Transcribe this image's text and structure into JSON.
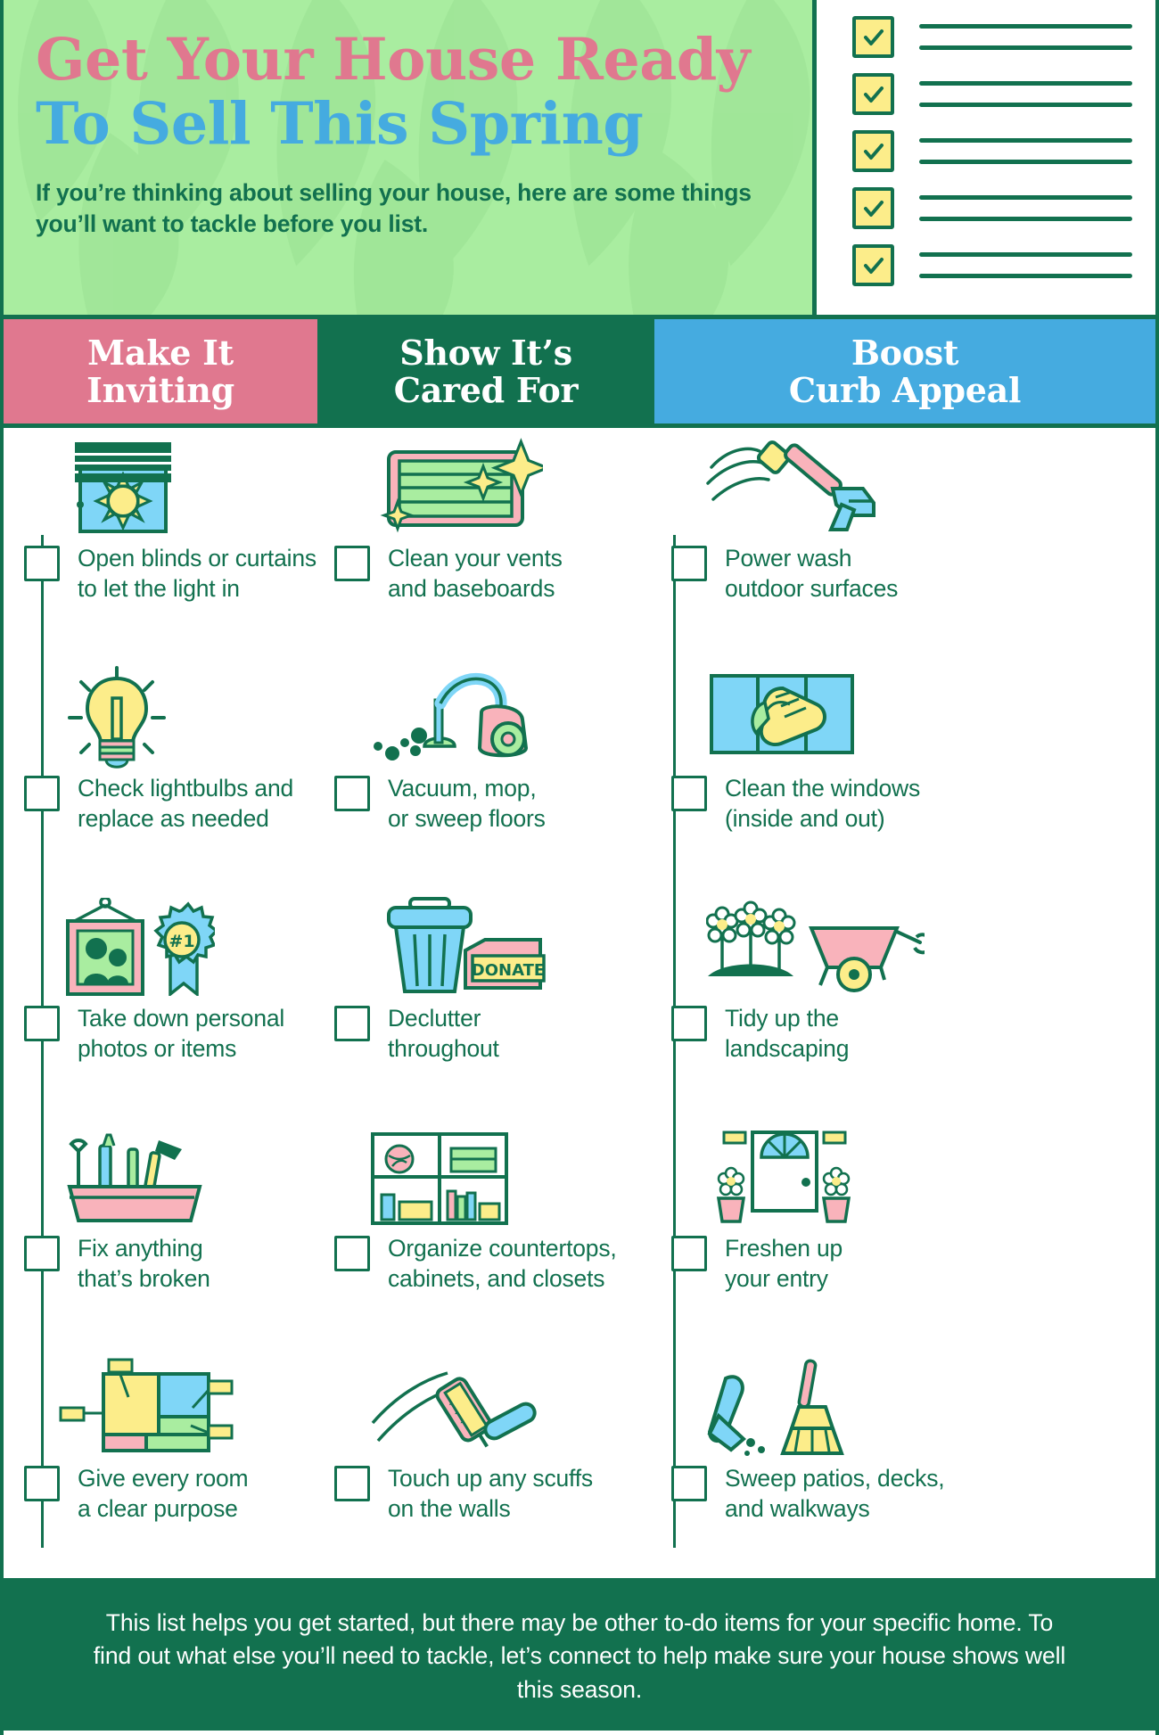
{
  "header": {
    "title_line1": "Get Your House Ready",
    "title_line2": "To Sell This Spring",
    "subtitle": "If you’re thinking about selling your house, here are some things you’ll want to tackle before you list.",
    "checklist_graphic": {
      "rows": 5,
      "checkmark_icon": "check-icon",
      "box_fill": "#FCED8A",
      "box_border": "#12714F",
      "line_color": "#12714F"
    }
  },
  "colors": {
    "green": "#12714F",
    "light_green": "#A9EDA0",
    "pink": "#E0788F",
    "light_pink": "#F9B3BB",
    "blue": "#45ABE0",
    "light_blue": "#7FD6F7",
    "yellow": "#FCED8A",
    "white": "#FFFFFF"
  },
  "columns": [
    {
      "heading": "Make It\nInviting",
      "heading_line1": "Make It",
      "heading_line2": "Inviting",
      "accent": "#E0788F",
      "items": [
        {
          "icon": "window-blinds-sun-icon",
          "line1": "Open blinds or curtains",
          "line2": "to let the light in"
        },
        {
          "icon": "lightbulb-icon",
          "line1": "Check lightbulbs and",
          "line2": "replace as needed"
        },
        {
          "icon": "photo-frame-ribbon-icon",
          "line1": "Take down personal",
          "line2": "photos or items",
          "badge_text": "#1"
        },
        {
          "icon": "toolbox-icon",
          "line1": "Fix anything",
          "line2": "that’s broken"
        },
        {
          "icon": "floorplan-rooms-icon",
          "line1": "Give every room",
          "line2": "a clear purpose"
        }
      ]
    },
    {
      "heading_line1": "Show It’s",
      "heading_line2": "Cared For",
      "accent": "#12714F",
      "items": [
        {
          "icon": "air-vent-sparkle-icon",
          "line1": "Clean your vents",
          "line2": "and baseboards"
        },
        {
          "icon": "vacuum-cleaner-icon",
          "line1": "Vacuum, mop,",
          "line2": "or sweep floors"
        },
        {
          "icon": "trash-donate-box-icon",
          "line1": "Declutter",
          "line2": "throughout",
          "badge_text": "DONATE"
        },
        {
          "icon": "shelf-organizer-icon",
          "line1": "Organize countertops,",
          "line2": "cabinets, and closets"
        },
        {
          "icon": "paint-roller-icon",
          "line1": "Touch up any scuffs",
          "line2": "on the walls"
        }
      ]
    },
    {
      "heading_line1": "Boost",
      "heading_line2": "Curb Appeal",
      "accent": "#45ABE0",
      "items": [
        {
          "icon": "pressure-washer-icon",
          "line1": "Power wash",
          "line2": "outdoor surfaces"
        },
        {
          "icon": "window-squeegee-icon",
          "line1": "Clean the windows",
          "line2": "(inside and out)"
        },
        {
          "icon": "flowers-wheelbarrow-icon",
          "line1": "Tidy up the",
          "line2": "landscaping"
        },
        {
          "icon": "front-door-icon",
          "line1": "Freshen up",
          "line2": "your entry"
        },
        {
          "icon": "broom-dustpan-icon",
          "line1": "Sweep patios, decks,",
          "line2": "and walkways"
        }
      ]
    }
  ],
  "footer": {
    "text": "This list helps you get started, but there may be other to-do items for your specific home. To find out what else you’ll need to tackle, let’s connect to help make sure your house shows well this season."
  }
}
